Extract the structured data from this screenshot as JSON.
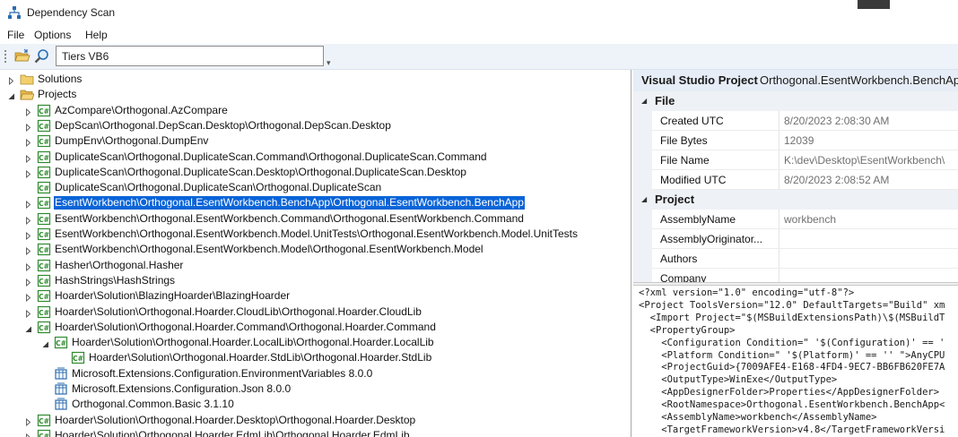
{
  "window": {
    "title": "Dependency Scan"
  },
  "menu": [
    "File",
    "Options",
    "Help"
  ],
  "toolbar": {
    "scope_value": "Tiers VB6"
  },
  "tree": [
    {
      "label": "Solutions",
      "depth": 0,
      "expander": "collapsed",
      "icon": "folder-closed-icon"
    },
    {
      "label": "Projects",
      "depth": 0,
      "expander": "expanded",
      "icon": "folder-open-icon"
    },
    {
      "label": "AzCompare\\Orthogonal.AzCompare",
      "depth": 1,
      "expander": "collapsed",
      "icon": "csharp-project-icon"
    },
    {
      "label": "DepScan\\Orthogonal.DepScan.Desktop\\Orthogonal.DepScan.Desktop",
      "depth": 1,
      "expander": "collapsed",
      "icon": "csharp-project-icon"
    },
    {
      "label": "DumpEnv\\Orthogonal.DumpEnv",
      "depth": 1,
      "expander": "collapsed",
      "icon": "csharp-project-icon"
    },
    {
      "label": "DuplicateScan\\Orthogonal.DuplicateScan.Command\\Orthogonal.DuplicateScan.Command",
      "depth": 1,
      "expander": "collapsed",
      "icon": "csharp-project-icon"
    },
    {
      "label": "DuplicateScan\\Orthogonal.DuplicateScan.Desktop\\Orthogonal.DuplicateScan.Desktop",
      "depth": 1,
      "expander": "collapsed",
      "icon": "csharp-project-icon"
    },
    {
      "label": "DuplicateScan\\Orthogonal.DuplicateScan\\Orthogonal.DuplicateScan",
      "depth": 1,
      "expander": "none",
      "icon": "csharp-project-icon"
    },
    {
      "label": "EsentWorkbench\\Orthogonal.EsentWorkbench.BenchApp\\Orthogonal.EsentWorkbench.BenchApp",
      "depth": 1,
      "expander": "collapsed",
      "icon": "csharp-project-icon",
      "selected": true
    },
    {
      "label": "EsentWorkbench\\Orthogonal.EsentWorkbench.Command\\Orthogonal.EsentWorkbench.Command",
      "depth": 1,
      "expander": "collapsed",
      "icon": "csharp-project-icon"
    },
    {
      "label": "EsentWorkbench\\Orthogonal.EsentWorkbench.Model.UnitTests\\Orthogonal.EsentWorkbench.Model.UnitTests",
      "depth": 1,
      "expander": "collapsed",
      "icon": "csharp-project-icon"
    },
    {
      "label": "EsentWorkbench\\Orthogonal.EsentWorkbench.Model\\Orthogonal.EsentWorkbench.Model",
      "depth": 1,
      "expander": "collapsed",
      "icon": "csharp-project-icon"
    },
    {
      "label": "Hasher\\Orthogonal.Hasher",
      "depth": 1,
      "expander": "collapsed",
      "icon": "csharp-project-icon"
    },
    {
      "label": "HashStrings\\HashStrings",
      "depth": 1,
      "expander": "collapsed",
      "icon": "csharp-project-icon"
    },
    {
      "label": "Hoarder\\Solution\\BlazingHoarder\\BlazingHoarder",
      "depth": 1,
      "expander": "collapsed",
      "icon": "csharp-project-icon"
    },
    {
      "label": "Hoarder\\Solution\\Orthogonal.Hoarder.CloudLib\\Orthogonal.Hoarder.CloudLib",
      "depth": 1,
      "expander": "collapsed",
      "icon": "csharp-project-icon"
    },
    {
      "label": "Hoarder\\Solution\\Orthogonal.Hoarder.Command\\Orthogonal.Hoarder.Command",
      "depth": 1,
      "expander": "expanded",
      "icon": "csharp-project-icon"
    },
    {
      "label": "Hoarder\\Solution\\Orthogonal.Hoarder.LocalLib\\Orthogonal.Hoarder.LocalLib",
      "depth": 2,
      "expander": "expanded",
      "icon": "csharp-project-icon"
    },
    {
      "label": "Hoarder\\Solution\\Orthogonal.Hoarder.StdLib\\Orthogonal.Hoarder.StdLib",
      "depth": 3,
      "expander": "none",
      "icon": "csharp-project-icon"
    },
    {
      "label": "Microsoft.Extensions.Configuration.EnvironmentVariables 8.0.0",
      "depth": 2,
      "expander": "none",
      "icon": "nuget-package-icon"
    },
    {
      "label": "Microsoft.Extensions.Configuration.Json 8.0.0",
      "depth": 2,
      "expander": "none",
      "icon": "nuget-package-icon"
    },
    {
      "label": "Orthogonal.Common.Basic 3.1.10",
      "depth": 2,
      "expander": "none",
      "icon": "nuget-package-icon"
    },
    {
      "label": "Hoarder\\Solution\\Orthogonal.Hoarder.Desktop\\Orthogonal.Hoarder.Desktop",
      "depth": 1,
      "expander": "collapsed",
      "icon": "csharp-project-icon"
    },
    {
      "label": "Hoarder\\Solution\\Orthogonal.Hoarder.EdmLib\\Orthogonal.Hoarder.EdmLib",
      "depth": 1,
      "expander": "collapsed",
      "icon": "csharp-project-icon"
    }
  ],
  "properties": {
    "header_type": "Visual Studio Project",
    "header_name": "Orthogonal.EsentWorkbench.BenchApp",
    "categories": [
      {
        "name": "File",
        "items": [
          {
            "key": "Created UTC",
            "value": "8/20/2023 2:08:30 AM"
          },
          {
            "key": "File Bytes",
            "value": "12039"
          },
          {
            "key": "File Name",
            "value": "K:\\dev\\Desktop\\EsentWorkbench\\"
          },
          {
            "key": "Modified UTC",
            "value": "8/20/2023 2:08:52 AM"
          }
        ]
      },
      {
        "name": "Project",
        "items": [
          {
            "key": "AssemblyName",
            "value": "workbench"
          },
          {
            "key": "AssemblyOriginator...",
            "value": ""
          },
          {
            "key": "Authors",
            "value": ""
          },
          {
            "key": "Company",
            "value": ""
          }
        ]
      }
    ]
  },
  "xml_lines": [
    "<?xml version=\"1.0\" encoding=\"utf-8\"?>",
    "<Project ToolsVersion=\"12.0\" DefaultTargets=\"Build\" xm",
    "  <Import Project=\"$(MSBuildExtensionsPath)\\$(MSBuildT",
    "  <PropertyGroup>",
    "    <Configuration Condition=\" '$(Configuration)' == '",
    "    <Platform Condition=\" '$(Platform)' == '' \">AnyCPU",
    "    <ProjectGuid>{7009AFE4-E168-4FD4-9EC7-BB6FB620FE7A",
    "    <OutputType>WinExe</OutputType>",
    "    <AppDesignerFolder>Properties</AppDesignerFolder>",
    "    <RootNamespace>Orthogonal.EsentWorkbench.BenchApp<",
    "    <AssemblyName>workbench</AssemblyName>",
    "    <TargetFrameworkVersion>v4.8</TargetFrameworkVersi"
  ],
  "colors": {
    "selection": "#0a64d8",
    "toolbar": "#eef3fa",
    "category_bg": "#eef1f5",
    "csharp_icon": "#2f8a2f",
    "nuget_icon": "#2b6cb0",
    "folder": "#e8b84a"
  }
}
